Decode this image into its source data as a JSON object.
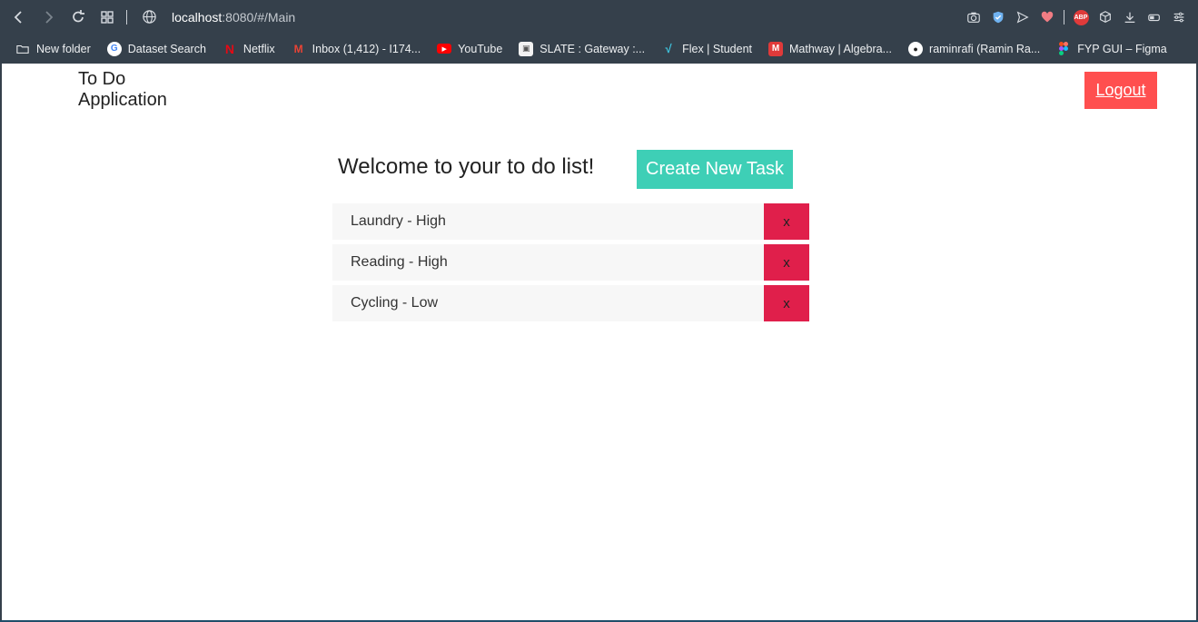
{
  "browser": {
    "url_host": "localhost",
    "url_rest": ":8080/#/Main",
    "bookmarks": [
      {
        "label": "New folder",
        "icon": "folder-icon"
      },
      {
        "label": "Dataset Search",
        "icon": "google-icon"
      },
      {
        "label": "Netflix",
        "icon": "netflix-icon"
      },
      {
        "label": "Inbox (1,412) - I174...",
        "icon": "gmail-icon"
      },
      {
        "label": "YouTube",
        "icon": "youtube-icon"
      },
      {
        "label": "SLATE : Gateway :...",
        "icon": "slate-icon"
      },
      {
        "label": "Flex | Student",
        "icon": "flex-icon"
      },
      {
        "label": "Mathway | Algebra...",
        "icon": "mathway-icon"
      },
      {
        "label": "raminrafi (Ramin Ra...",
        "icon": "github-icon"
      },
      {
        "label": "FYP GUI – Figma",
        "icon": "figma-icon"
      }
    ],
    "extension_abp": "ABP"
  },
  "app": {
    "title": "To Do Application",
    "logout_label": "Logout",
    "welcome_text": "Welcome to your to do list!",
    "create_label": "Create New Task",
    "delete_label": "x",
    "tasks": [
      {
        "label": "Laundry - High"
      },
      {
        "label": "Reading - High"
      },
      {
        "label": "Cycling - Low"
      }
    ]
  },
  "colors": {
    "chrome_bg": "#35404b",
    "logout_bg": "#ff4f4f",
    "create_bg": "#3ecfb6",
    "delete_bg": "#e01f4b",
    "task_bg": "#f7f7f7"
  }
}
